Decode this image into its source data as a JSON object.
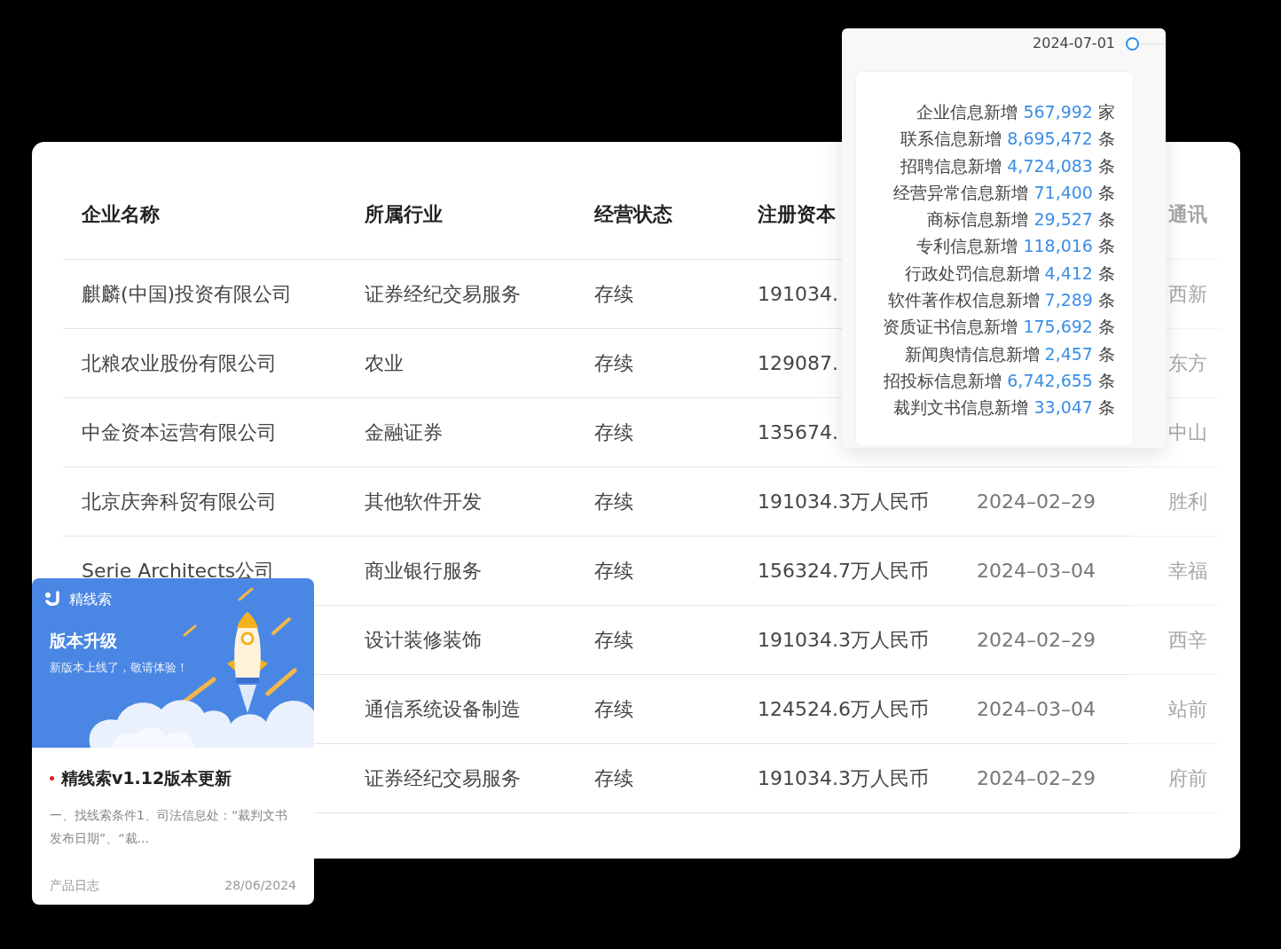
{
  "table": {
    "columns": [
      "企业名称",
      "所属行业",
      "经营状态",
      "注册资本",
      null,
      "通讯"
    ],
    "rows": [
      {
        "cells": [
          "麒麟(中国)投资有限公司",
          "证券经纪交易服务",
          "存续",
          "191034.",
          null,
          "西新"
        ]
      },
      {
        "cells": [
          "北粮农业股份有限公司",
          "农业",
          "存续",
          "129087.",
          null,
          "东方"
        ]
      },
      {
        "cells": [
          "中金资本运营有限公司",
          "金融证券",
          "存续",
          "135674.",
          null,
          "中山"
        ]
      },
      {
        "cells": [
          "北京庆奔科贸有限公司",
          "其他软件开发",
          "存续",
          "191034.3万人民币",
          "2024–02–29",
          "胜利"
        ]
      },
      {
        "cells": [
          "Serie Architects公司",
          "商业银行服务",
          "存续",
          "156324.7万人民币",
          "2024–03–04",
          "幸福"
        ]
      },
      {
        "cells": [
          null,
          "设计装修装饰",
          "存续",
          "191034.3万人民币",
          "2024–02–29",
          "西辛"
        ]
      },
      {
        "cells": [
          null,
          "通信系统设备制造",
          "存续",
          "124524.6万人民币",
          "2024–03–04",
          "站前"
        ]
      },
      {
        "cells": [
          null,
          "证券经纪交易服务",
          "存续",
          "191034.3万人民币",
          "2024–02–29",
          "府前"
        ]
      }
    ]
  },
  "update_popup": {
    "date": "2024-07-01",
    "stats": [
      {
        "label": "企业信息新增",
        "value": "567,992",
        "unit": "家"
      },
      {
        "label": "联系信息新增",
        "value": "8,695,472",
        "unit": "条"
      },
      {
        "label": "招聘信息新增",
        "value": "4,724,083",
        "unit": "条"
      },
      {
        "label": "经营异常信息新增",
        "value": "71,400",
        "unit": "条"
      },
      {
        "label": "商标信息新增",
        "value": "29,527",
        "unit": "条"
      },
      {
        "label": "专利信息新增",
        "value": "118,016",
        "unit": "条"
      },
      {
        "label": "行政处罚信息新增",
        "value": "4,412",
        "unit": "条"
      },
      {
        "label": "软件著作权信息新增",
        "value": "7,289",
        "unit": "条"
      },
      {
        "label": "资质证书信息新增",
        "value": "175,692",
        "unit": "条"
      },
      {
        "label": "新闻舆情信息新增",
        "value": "2,457",
        "unit": "条"
      },
      {
        "label": "招投标信息新增",
        "value": "6,742,655",
        "unit": "条"
      },
      {
        "label": "裁判文书信息新增",
        "value": "33,047",
        "unit": "条"
      }
    ]
  },
  "news_card": {
    "brand": "精线索",
    "banner_title": "版本升级",
    "banner_subtitle": "新版本上线了，敬请体验！",
    "title": "精线索v1.12版本更新",
    "unread": true,
    "excerpt": "一、找线索条件1、司法信息处：“裁判文书发布日期”、“裁...",
    "category": "产品日志",
    "date": "28/06/2024"
  }
}
